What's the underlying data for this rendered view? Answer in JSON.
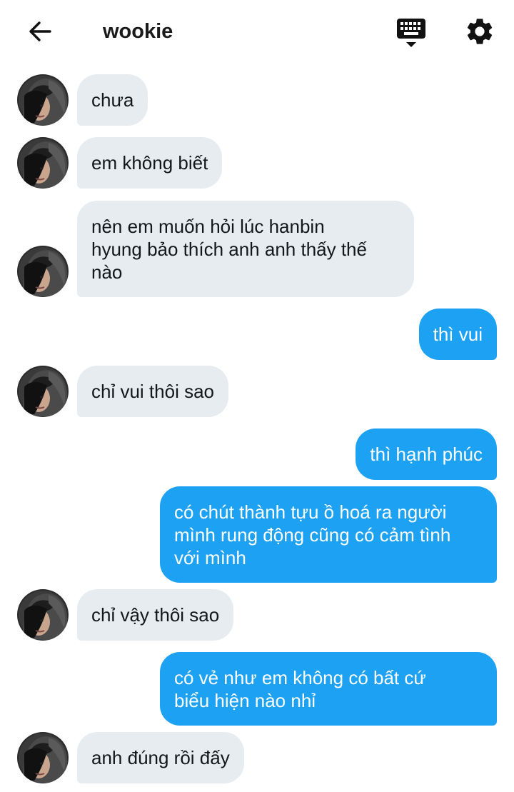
{
  "header": {
    "title": "wookie"
  },
  "colors": {
    "incoming_bubble": "#e6ecf0",
    "outgoing_bubble": "#1da1f2"
  },
  "icons": {
    "back": "arrow-left-icon",
    "keyboard": "keyboard-icon",
    "settings": "gear-icon"
  },
  "messages": [
    {
      "sender": "them",
      "text": "chưa"
    },
    {
      "sender": "them",
      "text": "em không biết"
    },
    {
      "sender": "them",
      "text": "nên em muốn hỏi lúc hanbin\nhyung bảo thích anh anh thấy thế\nnào"
    },
    {
      "sender": "me",
      "text": "thì vui"
    },
    {
      "sender": "them",
      "text": "chỉ vui thôi sao"
    },
    {
      "sender": "me",
      "text": "thì hạnh phúc"
    },
    {
      "sender": "me",
      "text": "có chút thành tựu ồ hoá ra người\nmình rung động cũng có cảm tình\nvới mình"
    },
    {
      "sender": "them",
      "text": "chỉ vậy thôi sao"
    },
    {
      "sender": "me",
      "text": "có vẻ như em không có bất cứ\nbiểu hiện nào nhỉ"
    },
    {
      "sender": "them",
      "text": "anh đúng rồi đấy"
    }
  ]
}
